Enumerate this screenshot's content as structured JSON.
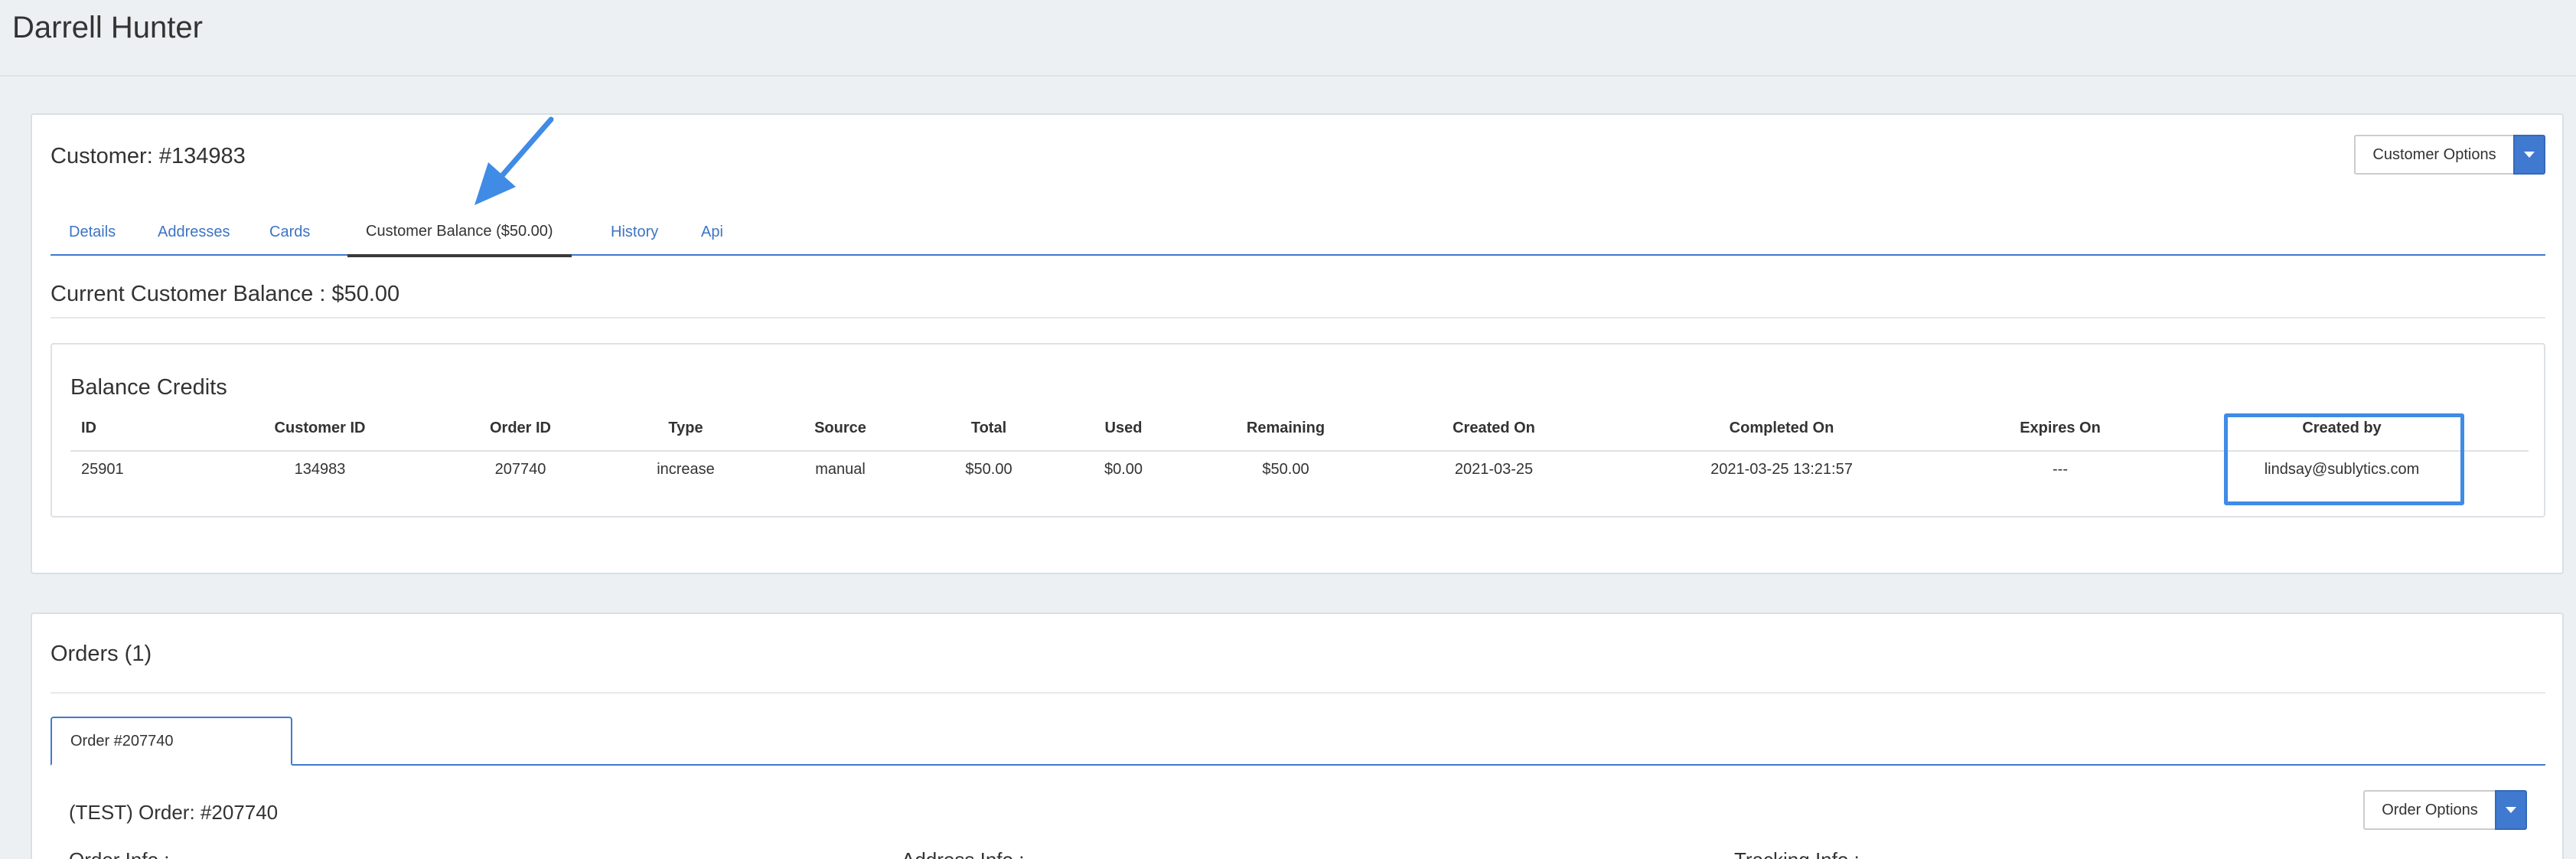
{
  "page": {
    "title": "Darrell Hunter"
  },
  "customer_panel": {
    "title": "Customer: #134983",
    "options_button": "Customer Options",
    "tabs": [
      {
        "label": "Details"
      },
      {
        "label": "Addresses"
      },
      {
        "label": "Cards"
      },
      {
        "label": "Customer Balance ($50.00)"
      },
      {
        "label": "History"
      },
      {
        "label": "Api"
      }
    ],
    "active_tab": "Customer Balance ($50.00)",
    "balance_heading": "Current Customer Balance : $50.00",
    "balance_credits": {
      "title": "Balance Credits",
      "columns": [
        "ID",
        "Customer ID",
        "Order ID",
        "Type",
        "Source",
        "Total",
        "Used",
        "Remaining",
        "Created On",
        "Completed On",
        "Expires On",
        "Created by"
      ],
      "rows": [
        [
          "25901",
          "134983",
          "207740",
          "increase",
          "manual",
          "$50.00",
          "$0.00",
          "$50.00",
          "2021-03-25",
          "2021-03-25 13:21:57",
          "---",
          "lindsay@sublytics.com"
        ]
      ]
    }
  },
  "orders_panel": {
    "title": "Orders (1)",
    "tab_label": "Order #207740",
    "order_heading": "(TEST) Order: #207740",
    "options_button": "Order Options",
    "sections": [
      "Order Info :",
      "Address Info :",
      "Tracking Info :"
    ]
  },
  "colors": {
    "accent": "#3f7ad0",
    "highlight": "#3f8be6",
    "background": "#ecf0f3"
  },
  "icons": {
    "annotation_arrow": "arrow-down-left-icon",
    "dropdown_caret": "caret-down-icon"
  }
}
